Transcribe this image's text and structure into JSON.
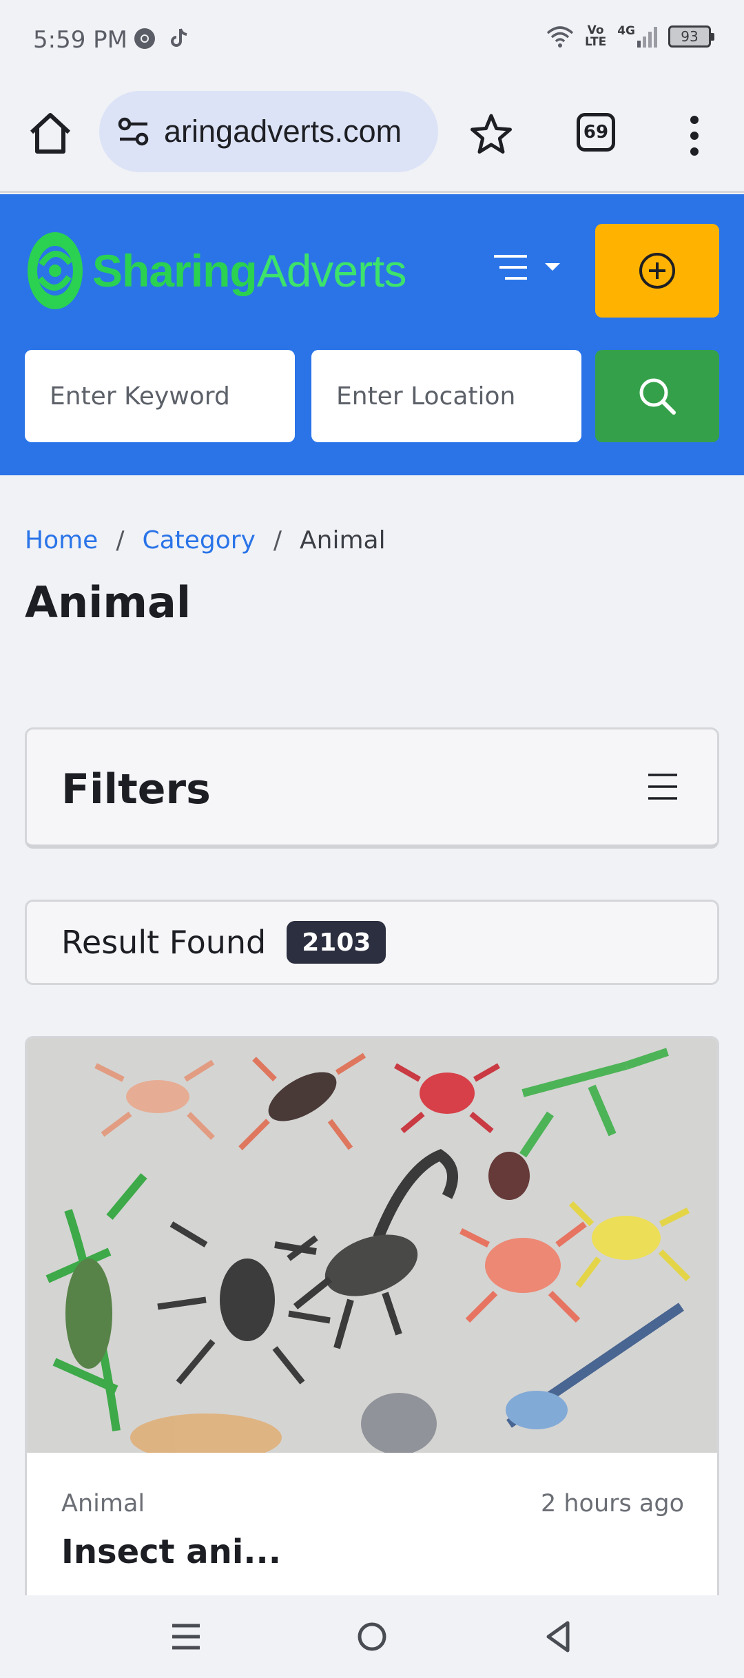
{
  "status_bar": {
    "time": "5:59 PM",
    "app_icons": [
      "chrome-icon",
      "tiktok-icon"
    ],
    "network_top": "Vo",
    "network_bottom": "LTE",
    "network_type": "4G",
    "battery": "93"
  },
  "browser": {
    "url": "aringadverts.com",
    "tab_count": "69"
  },
  "site": {
    "logo_bold": "Sharing",
    "logo_light": "Adverts",
    "search": {
      "keyword_placeholder": "Enter Keyword",
      "location_placeholder": "Enter Location"
    },
    "colors": {
      "header": "#2a74e8",
      "post_button": "#ffb300",
      "search_button": "#35a04a",
      "logo": "#2bd150"
    }
  },
  "breadcrumb": {
    "items": [
      "Home",
      "Category"
    ],
    "separator": "/",
    "current": "Animal"
  },
  "page": {
    "title": "Animal"
  },
  "filters": {
    "title": "Filters"
  },
  "results": {
    "label": "Result Found",
    "count": "2103"
  },
  "listing": {
    "category": "Animal",
    "time": "2 hours ago",
    "title": "Insect ani..."
  }
}
